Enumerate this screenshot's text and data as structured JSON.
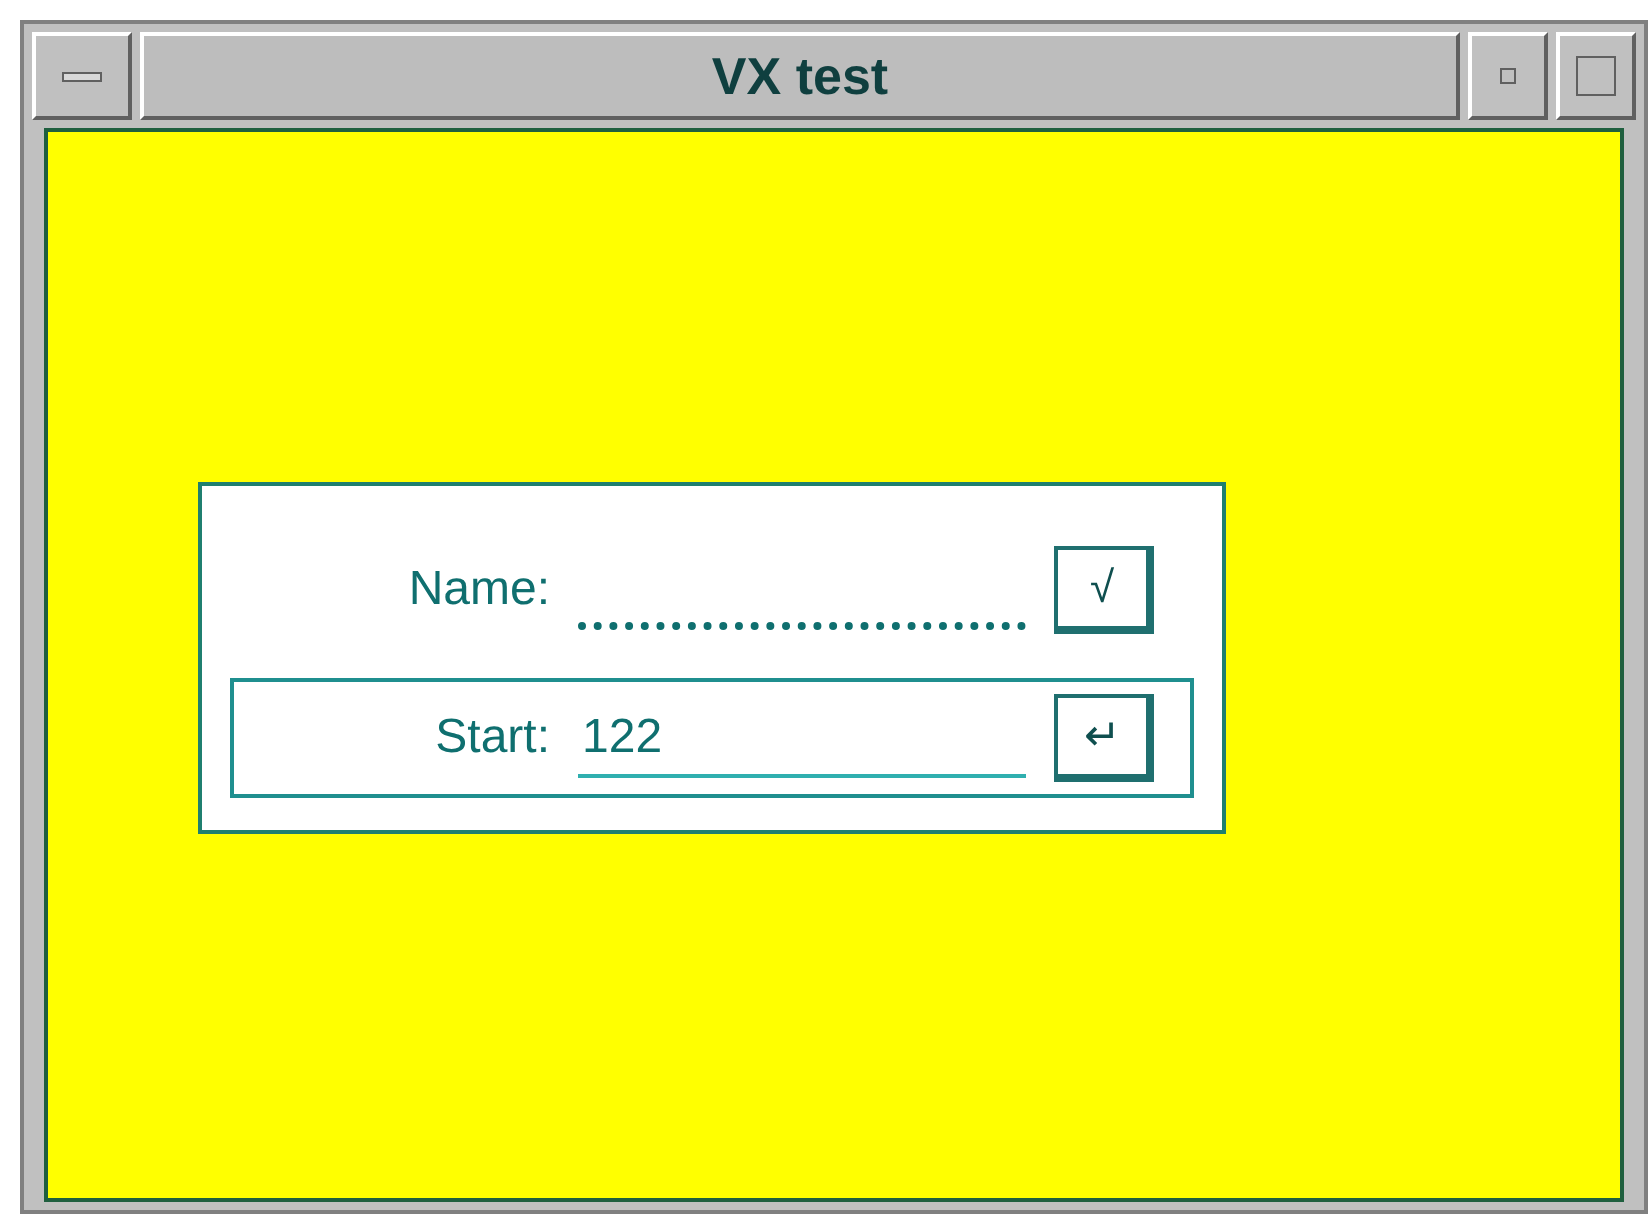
{
  "window": {
    "title": "VX test"
  },
  "fields": [
    {
      "label": "Name:",
      "focused": false,
      "button": "√"
    },
    {
      "label": "Start:",
      "value": "122",
      "focused": true,
      "button": "↵"
    }
  ]
}
